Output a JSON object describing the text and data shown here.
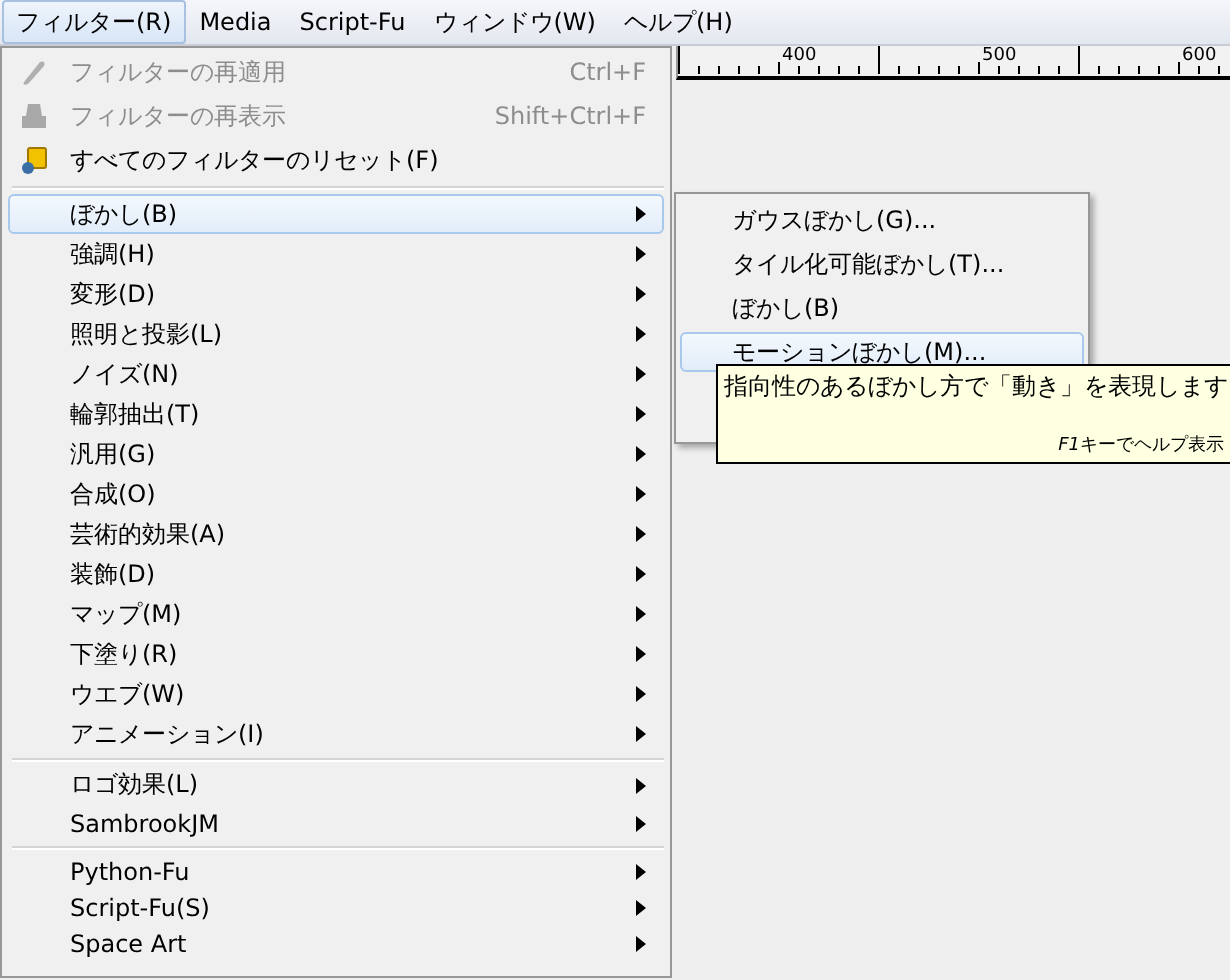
{
  "menubar": [
    {
      "label": "フィルター(R)",
      "selected": true
    },
    {
      "label": "Media",
      "selected": false
    },
    {
      "label": "Script-Fu",
      "selected": false
    },
    {
      "label": "ウィンドウ(W)",
      "selected": false
    },
    {
      "label": "ヘルプ(H)",
      "selected": false
    }
  ],
  "ruler": {
    "labels": [
      "400",
      "500",
      "600"
    ]
  },
  "menu": {
    "groups": [
      [
        {
          "label": "フィルターの再適用",
          "shortcut": "Ctrl+F",
          "disabled": true,
          "submenu": false,
          "selected": false
        },
        {
          "label": "フィルターの再表示",
          "shortcut": "Shift+Ctrl+F",
          "disabled": true,
          "submenu": false,
          "selected": false
        },
        {
          "label": "すべてのフィルターのリセット(F)",
          "disabled": false,
          "submenu": false,
          "selected": false
        }
      ],
      [
        {
          "label": "ぼかし(B)",
          "disabled": false,
          "submenu": true,
          "selected": true
        },
        {
          "label": "強調(H)",
          "disabled": false,
          "submenu": true,
          "selected": false
        },
        {
          "label": "変形(D)",
          "disabled": false,
          "submenu": true,
          "selected": false
        },
        {
          "label": "照明と投影(L)",
          "disabled": false,
          "submenu": true,
          "selected": false
        },
        {
          "label": "ノイズ(N)",
          "disabled": false,
          "submenu": true,
          "selected": false
        },
        {
          "label": "輪郭抽出(T)",
          "disabled": false,
          "submenu": true,
          "selected": false
        },
        {
          "label": "汎用(G)",
          "disabled": false,
          "submenu": true,
          "selected": false
        },
        {
          "label": "合成(O)",
          "disabled": false,
          "submenu": true,
          "selected": false
        },
        {
          "label": "芸術的効果(A)",
          "disabled": false,
          "submenu": true,
          "selected": false
        },
        {
          "label": "装飾(D)",
          "disabled": false,
          "submenu": true,
          "selected": false
        },
        {
          "label": "マップ(M)",
          "disabled": false,
          "submenu": true,
          "selected": false
        },
        {
          "label": "下塗り(R)",
          "disabled": false,
          "submenu": true,
          "selected": false
        },
        {
          "label": "ウエブ(W)",
          "disabled": false,
          "submenu": true,
          "selected": false
        },
        {
          "label": "アニメーション(I)",
          "disabled": false,
          "submenu": true,
          "selected": false
        }
      ],
      [
        {
          "label": "ロゴ効果(L)",
          "disabled": false,
          "submenu": true,
          "selected": false
        },
        {
          "label": "SambrookJM",
          "disabled": false,
          "submenu": true,
          "selected": false
        }
      ],
      [
        {
          "label": "Python-Fu",
          "disabled": false,
          "submenu": true,
          "selected": false
        },
        {
          "label": "Script-Fu(S)",
          "disabled": false,
          "submenu": true,
          "selected": false
        },
        {
          "label": "Space Art",
          "disabled": false,
          "submenu": true,
          "selected": false
        }
      ]
    ]
  },
  "submenu": {
    "items": [
      {
        "label": "ガウスぼかし(G)...",
        "selected": false
      },
      {
        "label": "タイル化可能ぼかし(T)...",
        "selected": false
      },
      {
        "label": "ぼかし(B)",
        "selected": false
      },
      {
        "label": "モーションぼかし(M)...",
        "selected": true
      }
    ]
  },
  "tooltip": {
    "text": "指向性のあるぼかし方で「動き」を表現します",
    "hint": {
      "key": "F1",
      "text": "キーでヘルプ表示"
    }
  }
}
